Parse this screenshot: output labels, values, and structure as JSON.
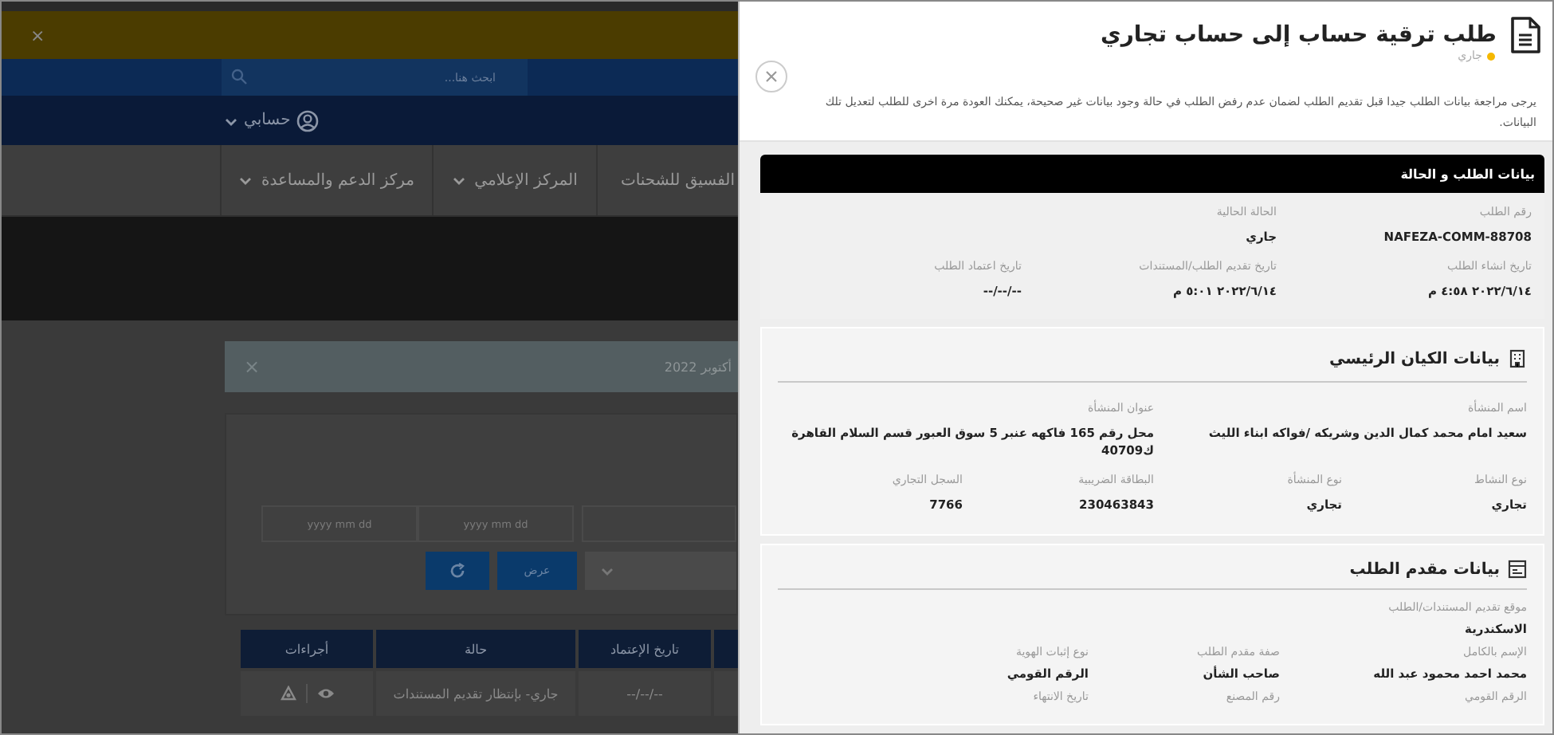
{
  "background_page": {
    "banner": {
      "close": "×"
    },
    "search": {
      "placeholder": "ابحث هنا..."
    },
    "account": {
      "label": "حسابي"
    },
    "nav": [
      {
        "label": "الفسيق للشحنات"
      },
      {
        "label": "المركز الإعلامي"
      },
      {
        "label": "مركز الدعم والمساعدة"
      }
    ],
    "alert": {
      "text": "أكتوبر 2022",
      "close": "×"
    },
    "filters": {
      "date_fields": [
        {
          "placeholder": "yyyy mm dd"
        },
        {
          "placeholder": "yyyy mm dd"
        }
      ],
      "show_button": "عرض"
    },
    "table": {
      "columns": [
        "تاريخ الإعتماد",
        "حالة",
        "أجراءات"
      ],
      "rows": [
        {
          "status": "جاري- بإنتظار تقديم المستندات",
          "approval_date": "--/--/--"
        }
      ]
    }
  },
  "panel": {
    "title": "طلب ترقية حساب إلى حساب تجاري",
    "status": {
      "label": "جاري",
      "color": "#f5b800"
    },
    "description": "يرجى مراجعة بيانات الطلب جيدا قبل تقديم الطلب لضمان عدم رفض الطلب في حالة وجود بيانات غير صحيحة، يمكنك العودة مرة اخرى للطلب لتعديل تلك البيانات.",
    "sections": [
      {
        "kind": "banner",
        "title": "بيانات الطلب و الحالة",
        "rows": [
          [
            {
              "label": "رقم الطلب",
              "value": "NAFEZA-COMM-88708"
            },
            {
              "label": "الحالة الحالية",
              "value": "جاري"
            }
          ],
          [
            {
              "label": "تاريخ انشاء الطلب",
              "value": "٢٠٢٢/٦/١٤ ٤:٥٨ م"
            },
            {
              "label": "تاريخ تقديم الطلب/المستندات",
              "value": "٢٠٢٢/٦/١٤ ٥:٠١ م"
            },
            {
              "label": "تاريخ اعتماد الطلب",
              "value": "--/--/--"
            }
          ]
        ]
      },
      {
        "kind": "card",
        "title": "بيانات الكيان الرئيسي",
        "rows": [
          [
            {
              "label": "اسم المنشأة",
              "value": "سعيد امام محمد كمال الدين وشريكه /فواكه ابناء الليث"
            },
            null,
            {
              "label": "عنوان المنشأة",
              "value": "محل رقم 165 فاكهه عنبر 5 سوق العبور قسم السلام القاهرة ك40709"
            }
          ],
          [
            {
              "label": "نوع النشاط",
              "value": "تجاري"
            },
            {
              "label": "نوع المنشأة",
              "value": "تجاري"
            },
            {
              "label": "البطاقة الضريبية",
              "value": "230463843"
            },
            {
              "label": "السجل التجاري",
              "value": "7766"
            }
          ]
        ]
      },
      {
        "kind": "card",
        "title": "بيانات مقدم الطلب",
        "rows": [
          [
            {
              "label": "موقع تقديم المستندات/الطلب",
              "value": "الاسكندرية"
            }
          ],
          [
            {
              "label": "الإسم بالكامل",
              "value": "محمد احمد محمود عبد الله"
            },
            {
              "label": "صفة مقدم الطلب",
              "value": "صاحب الشأن"
            },
            {
              "label": "نوع إثبات الهوية",
              "value": "الرقم القومي"
            }
          ],
          [
            {
              "label": "الرقم القومي"
            },
            {
              "label": "رقم المصنع"
            },
            {
              "label": "تاريخ الانتهاء"
            }
          ]
        ]
      }
    ]
  }
}
